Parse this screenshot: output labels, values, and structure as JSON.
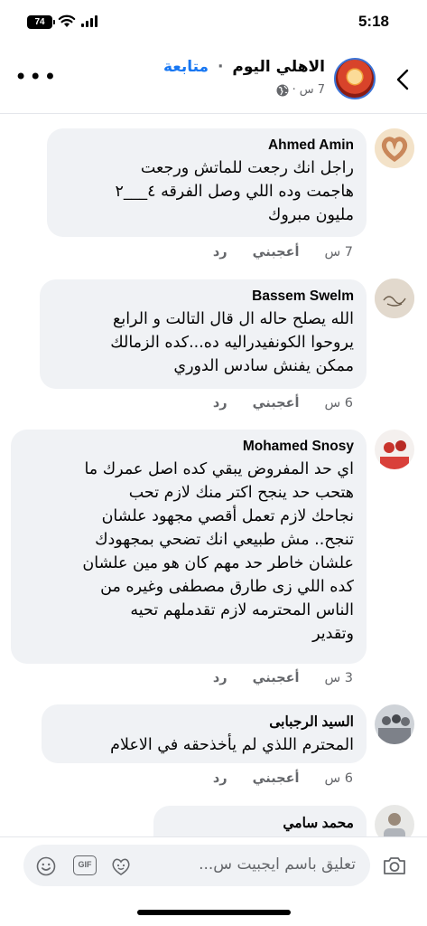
{
  "status_bar": {
    "time": "5:18",
    "battery": "74"
  },
  "header": {
    "page_name": "الاهلي اليوم",
    "follow_label": "متابعة",
    "dot": "·",
    "time_ago": "7 س",
    "audience_icon": "globe-icon"
  },
  "comments": [
    {
      "author": "Ahmed Amin",
      "text": "راجل انك رجعت للماتش ورجعت\nهاجمت وده اللي وصل الفرقه ٤___٢\nمليون مبروك",
      "time": "7 س",
      "like_label": "أعجبني",
      "reply_label": "رد"
    },
    {
      "author": "Bassem Swelm",
      "text": "الله يصلح حاله ال قال التالت و الرابع\nيروحوا الكونفيدراليه ده...كده الزمالك\nممكن يفنش سادس الدوري",
      "time": "6 س",
      "like_label": "أعجبني",
      "reply_label": "رد"
    },
    {
      "author": "Mohamed Snosy",
      "text": "اي حد المفروض يبقي كده اصل عمرك ما\nهتحب حد ينجح اكتر منك لازم تحب\nنجاحك لازم تعمل أقصي مجهود علشان\nتنجح.. مش طبيعي انك تضحي بمجهودك\nعلشان خاطر حد مهم كان هو مين علشان\nكده اللي زى طارق مصطفى وغيره من\nالناس المحترمه لازم تقدملهم تحيه\nوتقدير",
      "time": "3 س",
      "like_label": "أعجبني",
      "reply_label": "رد"
    },
    {
      "author": "السيد الرجبابى",
      "text": "المحترم اللذي لم يأخذحقه في الاعلام",
      "time": "6 س",
      "like_label": "أعجبني",
      "reply_label": "رد"
    },
    {
      "author": "محمد سامي",
      "text": "",
      "time": "",
      "like_label": "",
      "reply_label": ""
    }
  ],
  "composer": {
    "placeholder": "تعليق باسم ايجبيت س...",
    "gif_label": "GIF"
  },
  "colors": {
    "accent": "#1877f2",
    "bubble": "#f0f2f5",
    "secondary_text": "#65676b"
  }
}
